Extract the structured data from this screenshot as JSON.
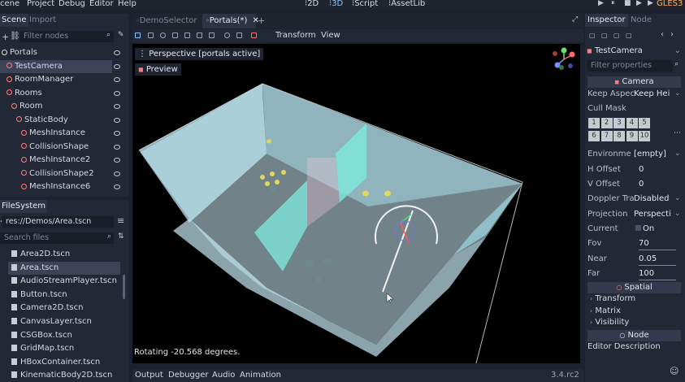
{
  "menu": [
    "cene",
    "Project",
    "Debug",
    "Editor",
    "Help"
  ],
  "workspaces": [
    {
      "label": "2D",
      "icon": "2d-icon"
    },
    {
      "label": "3D",
      "icon": "3d-icon"
    },
    {
      "label": "Script",
      "icon": "script-icon"
    },
    {
      "label": "AssetLib",
      "icon": "assetlib-icon"
    }
  ],
  "renderer": "GLES3",
  "scene_dock": {
    "tabs": [
      "Scene",
      "Import"
    ],
    "filter_placeholder": "Filter nodes",
    "nodes": [
      {
        "label": "Portals",
        "icon_color": "#e0e0e0",
        "indent": 0
      },
      {
        "label": "TestCamera",
        "icon_color": "#fc7f7f",
        "indent": 1,
        "selected": true
      },
      {
        "label": "RoomManager",
        "icon_color": "#fc7f7f",
        "indent": 1
      },
      {
        "label": "Rooms",
        "icon_color": "#fc7f7f",
        "indent": 1
      },
      {
        "label": "Room",
        "icon_color": "#fc7f7f",
        "indent": 2
      },
      {
        "label": "StaticBody",
        "icon_color": "#fc7f7f",
        "indent": 3
      },
      {
        "label": "MeshInstance",
        "icon_color": "#fc7f7f",
        "indent": 4
      },
      {
        "label": "CollisionShape",
        "icon_color": "#fc7f7f",
        "indent": 4
      },
      {
        "label": "MeshInstance2",
        "icon_color": "#fc7f7f",
        "indent": 4
      },
      {
        "label": "CollisionShape2",
        "icon_color": "#fc7f7f",
        "indent": 4
      },
      {
        "label": "MeshInstance6",
        "icon_color": "#fc7f7f",
        "indent": 4
      }
    ]
  },
  "filesystem": {
    "title": "FileSystem",
    "path": "res://Demos/Area.tscn",
    "search_placeholder": "Search files",
    "files": [
      "Area2D.tscn",
      "Area.tscn",
      "AudioStreamPlayer.tscn",
      "Button.tscn",
      "Camera2D.tscn",
      "CanvasLayer.tscn",
      "CSGBox.tscn",
      "GridMap.tscn",
      "HBoxContainer.tscn",
      "KinematicBody2D.tscn"
    ],
    "selected": "Area.tscn"
  },
  "viewport": {
    "tabs": [
      "DemoSelector",
      "Portals(*)"
    ],
    "menus": [
      "Transform",
      "View"
    ],
    "perspective_label": "Perspective [portals active]",
    "preview_label": "Preview",
    "status_text": "Rotating -20.568 degrees."
  },
  "bottom_panel": {
    "tabs": [
      "Output",
      "Debugger",
      "Audio",
      "Animation"
    ],
    "version": "3.4.rc2"
  },
  "inspector": {
    "tabs": [
      "Inspector",
      "Node"
    ],
    "object_name": "TestCamera",
    "filter_placeholder": "Filter properties",
    "camera_section": "Camera",
    "properties": [
      {
        "label": "Keep Aspec",
        "value": "Keep Hei"
      },
      {
        "label": "Cull Mask",
        "value": ""
      },
      {
        "label": "Environme",
        "value": "[empty]"
      },
      {
        "label": "H Offset",
        "value": "0"
      },
      {
        "label": "V Offset",
        "value": "0"
      },
      {
        "label": "Doppler Tra",
        "value": "Disabled"
      },
      {
        "label": "Projection",
        "value": "Perspecti"
      },
      {
        "label": "Current",
        "value": "On"
      },
      {
        "label": "Fov",
        "value": "70"
      },
      {
        "label": "Near",
        "value": "0.05"
      },
      {
        "label": "Far",
        "value": "100"
      }
    ],
    "cull_mask_layers": [
      "1",
      "2",
      "3",
      "4",
      "5",
      "6",
      "7",
      "8",
      "9",
      "10"
    ],
    "spatial_section": "Spatial",
    "spatial_items": [
      "Transform",
      "Matrix",
      "Visibility"
    ],
    "node_section": "Node",
    "editor_description": "Editor Description"
  }
}
